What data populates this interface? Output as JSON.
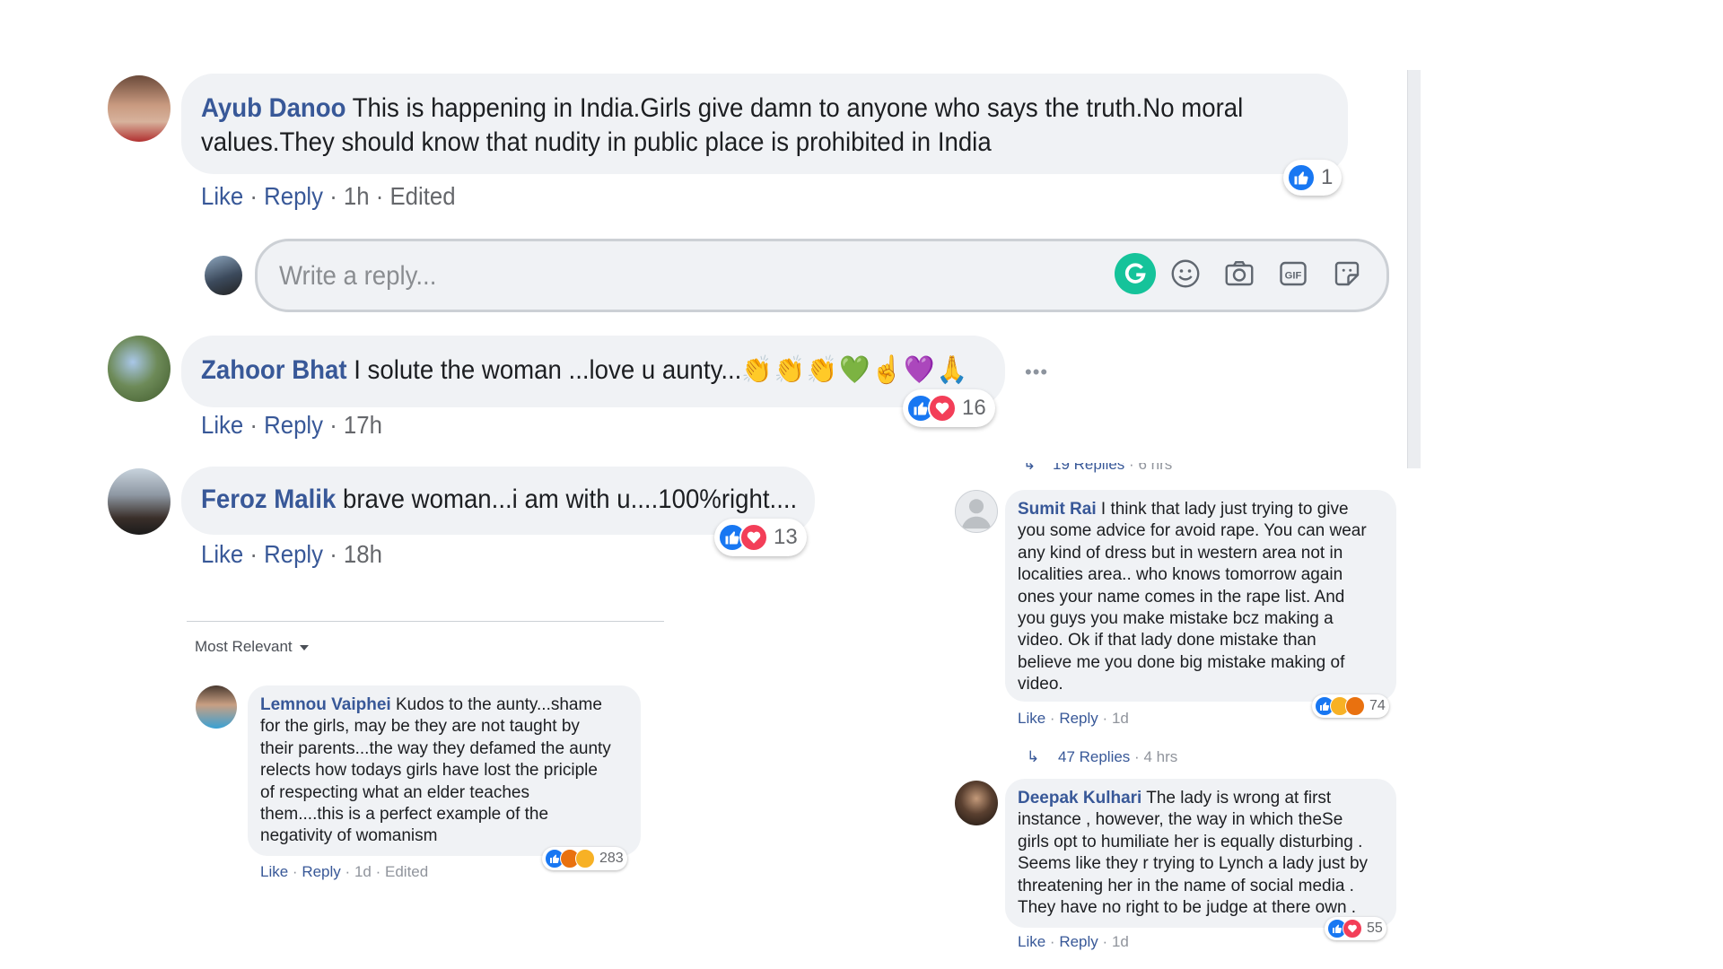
{
  "comments_main": [
    {
      "name": "Ayub Danoo",
      "text_line1": " This is happening in India.Girls give damn to anyone who says the truth.No moral",
      "text_line2": "values.They should know that nudity in public place is prohibited in India",
      "like": "Like",
      "reply": "Reply",
      "time": "1h",
      "edited": "Edited",
      "reaction_count": "1"
    },
    {
      "name": "Zahoor Bhat",
      "text": " I solute the woman ...love u aunty...",
      "emojis": "👏👏👏💚☝💜🙏",
      "like": "Like",
      "reply": "Reply",
      "time": "17h",
      "reaction_count": "16"
    },
    {
      "name": "Feroz Malik",
      "text": " brave woman...i am with u....100%right....",
      "like": "Like",
      "reply": "Reply",
      "time": "18h",
      "reaction_count": "13"
    }
  ],
  "reply_input": {
    "placeholder": "Write a reply..."
  },
  "more_options": "•••",
  "sort": {
    "label": "Most Relevant"
  },
  "comments_left": [
    {
      "name": "Lemnou Vaiphei",
      "lines": [
        " Kudos to the aunty...shame",
        "for the girls, may be they are not taught by",
        "their parents...the way they defamed the aunty",
        "relects how todays girls have lost the priciple",
        "of respecting what an elder teaches",
        "them....this is a perfect example of the",
        "negativity of womanism"
      ],
      "like": "Like",
      "reply": "Reply",
      "time": "1d",
      "edited": "Edited",
      "reaction_count": "283"
    }
  ],
  "comments_right": [
    {
      "replies_label": "19 Replies",
      "replies_time": "6 hrs"
    },
    {
      "name": "Sumit Rai",
      "lines": [
        " I think that lady just trying to give",
        "you some advice for avoid rape. You can wear",
        "any kind of dress but in western area not in",
        "localities area.. who knows tomorrow again",
        "ones your name comes in the rape list. And",
        "you guys you make mistake bcz making a",
        "video. Ok if that lady done mistake than",
        "believe me you done big mistake making of",
        "video."
      ],
      "like": "Like",
      "reply": "Reply",
      "time": "1d",
      "reaction_count": "74",
      "replies_label": "47 Replies",
      "replies_time": "4 hrs"
    },
    {
      "name": "Deepak Kulhari",
      "lines": [
        " The lady is wrong at first",
        "instance , however, the way in which theSe",
        "girls opt to humiliate her is equally disturbing .",
        "Seems like they r trying to Lynch a lady just by",
        "threatening her in the name of social media .",
        "They have no right to be judge at there own ."
      ],
      "like": "Like",
      "reply": "Reply",
      "time": "1d",
      "reaction_count": "55"
    }
  ],
  "separator": "·",
  "colors": {
    "name_blue": "#385898",
    "bubble_bg": "#f0f2f5",
    "like_blue": "#1877f2",
    "love_red": "#f33e58",
    "grammarly_green": "#15c39a"
  }
}
